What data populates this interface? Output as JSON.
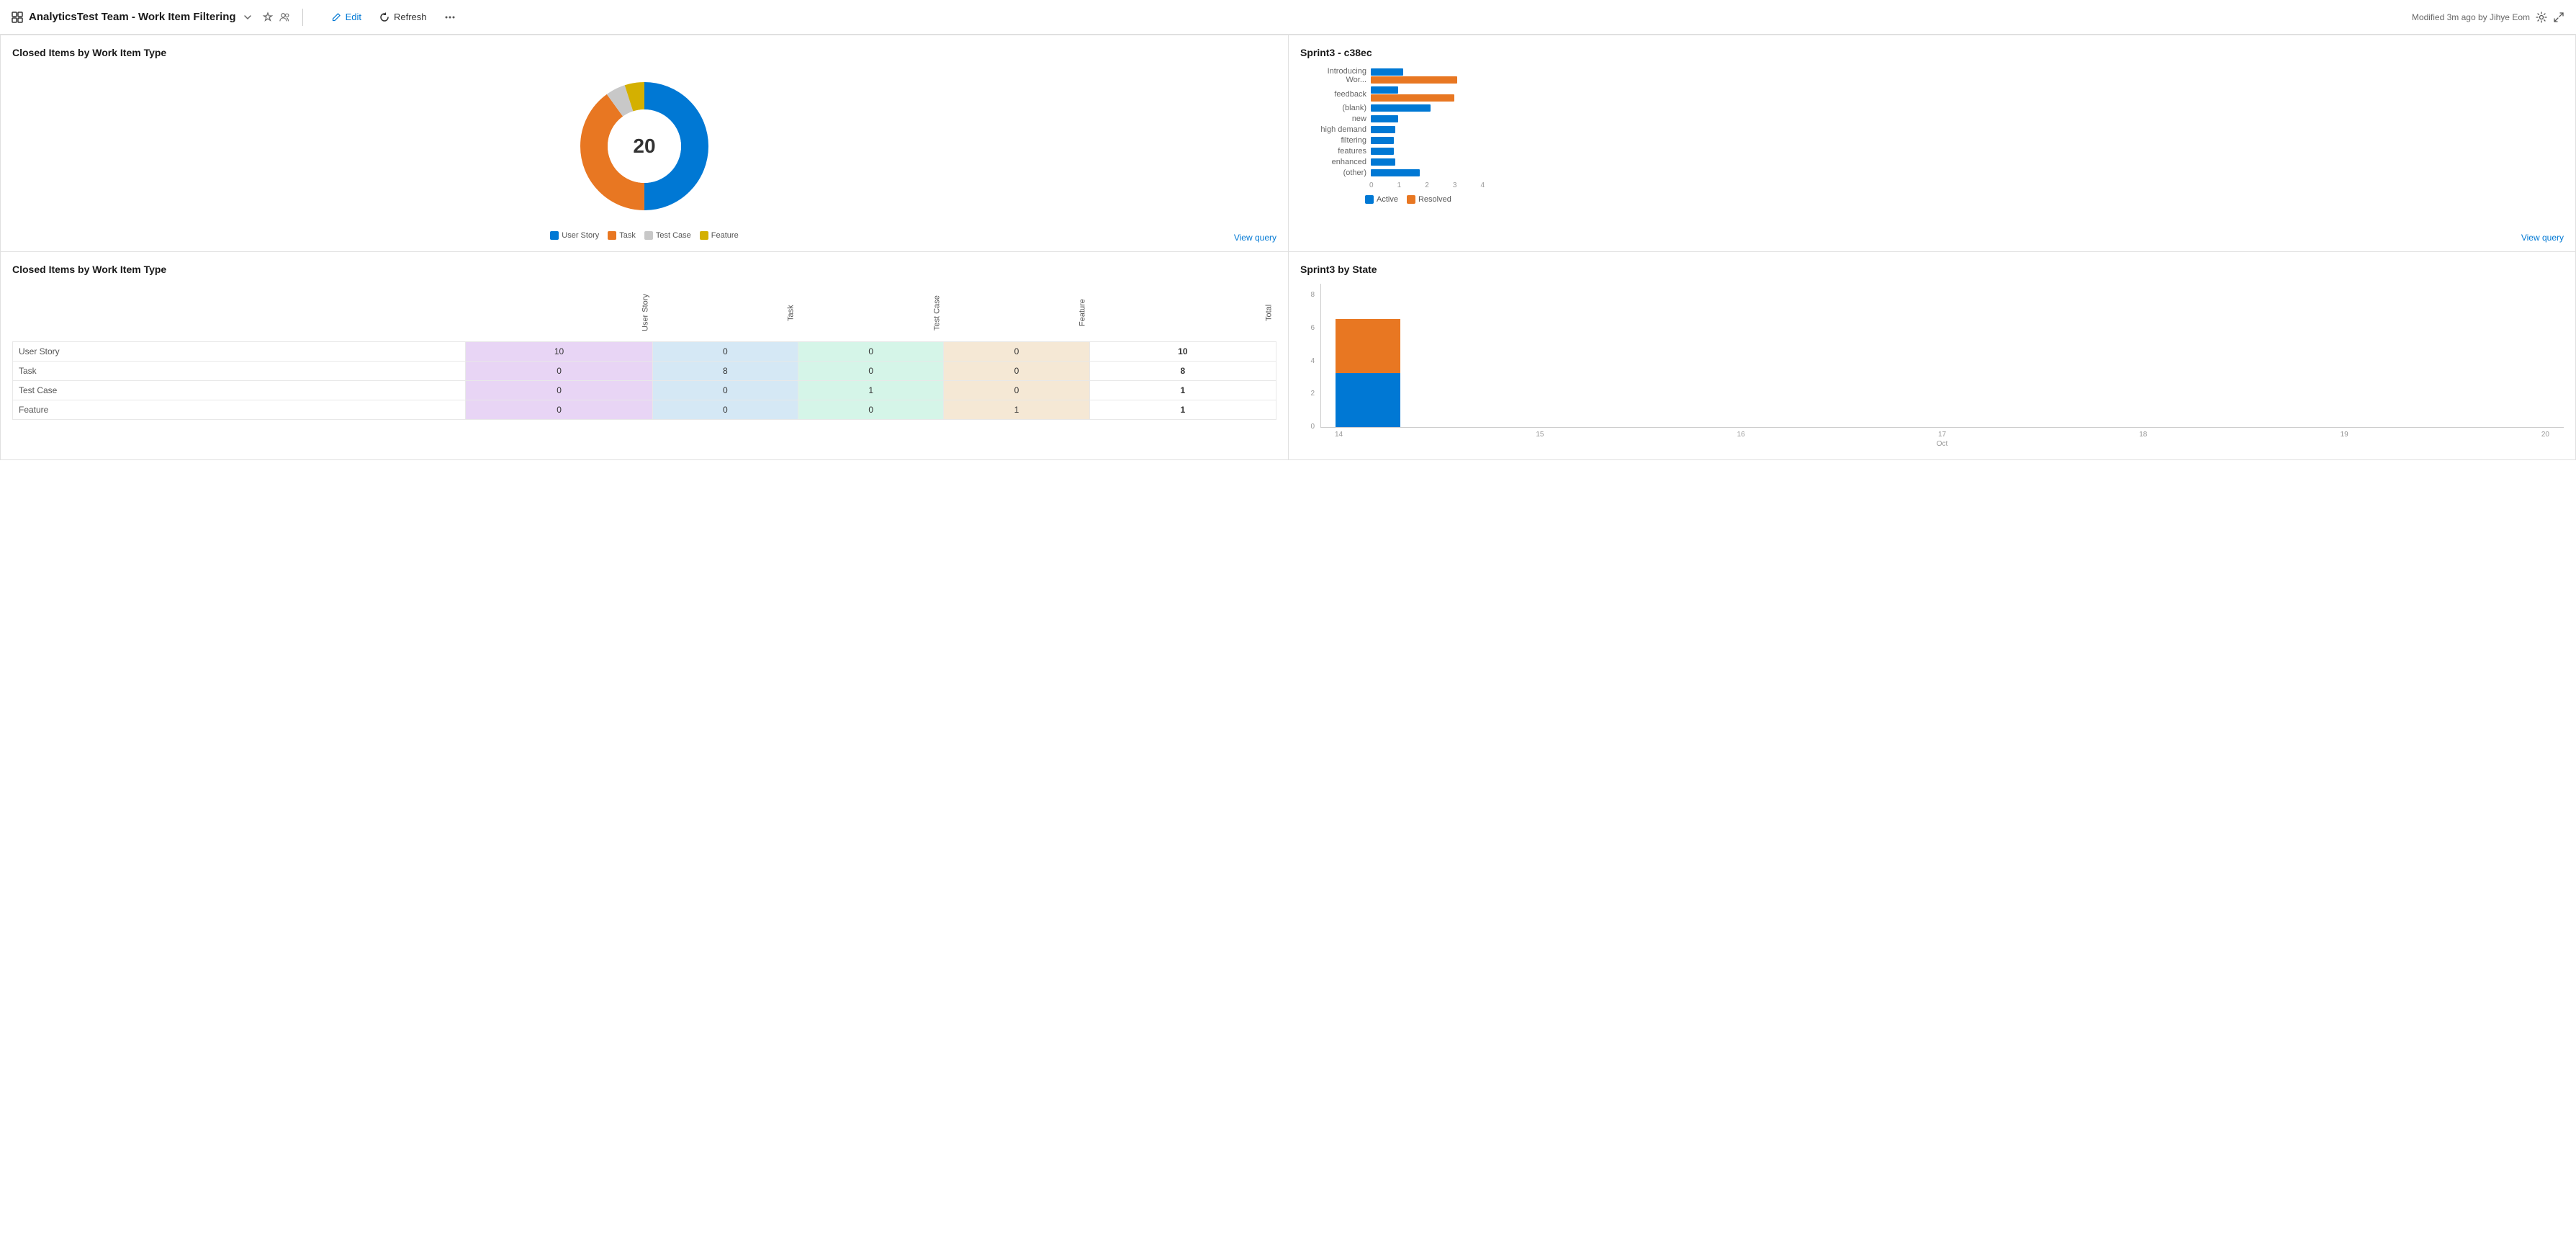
{
  "topbar": {
    "title": "AnalyticsTest Team - Work Item Filtering",
    "chevron_icon": "chevron-down",
    "star_icon": "star",
    "people_icon": "people",
    "edit_label": "Edit",
    "refresh_label": "Refresh",
    "more_icon": "ellipsis",
    "modified_text": "Modified 3m ago by Jihye Eom",
    "settings_icon": "settings",
    "expand_icon": "expand"
  },
  "widget1": {
    "title": "Closed Items by Work Item Type",
    "total": "20",
    "view_query": "View query",
    "donut": {
      "segments": [
        {
          "name": "User Story",
          "value": 10,
          "color": "#0078d4",
          "percent": 50
        },
        {
          "name": "Task",
          "value": 8,
          "color": "#e87722",
          "percent": 40
        },
        {
          "name": "Test Case",
          "value": 1,
          "color": "#c8c8c8",
          "percent": 5
        },
        {
          "name": "Feature",
          "value": 1,
          "color": "#d4b000",
          "percent": 5
        }
      ]
    },
    "labels": {
      "user_story": "User Story",
      "task": "Task",
      "test_case": "Test Case",
      "feature": "Feature"
    }
  },
  "widget2": {
    "title": "Sprint3 - c38ec",
    "view_query": "View query",
    "legend_active": "Active",
    "legend_resolved": "Resolved",
    "rows": [
      {
        "label": "Introducing Wor...",
        "active": 1.2,
        "resolved": 3.2
      },
      {
        "label": "feedback",
        "active": 1.0,
        "resolved": 3.1
      },
      {
        "label": "(blank)",
        "active": 2.2,
        "resolved": 0
      },
      {
        "label": "new",
        "active": 1.0,
        "resolved": 0
      },
      {
        "label": "high demand",
        "active": 0.9,
        "resolved": 0
      },
      {
        "label": "filtering",
        "active": 0.85,
        "resolved": 0
      },
      {
        "label": "features",
        "active": 0.85,
        "resolved": 0
      },
      {
        "label": "enhanced",
        "active": 0.9,
        "resolved": 0
      },
      {
        "label": "(other)",
        "active": 1.8,
        "resolved": 0
      }
    ],
    "axis": [
      "0",
      "1",
      "2",
      "3",
      "4"
    ]
  },
  "widget3": {
    "title": "Closed Items by Work Item Type",
    "col_headers": [
      "User Story",
      "Task",
      "Test Case",
      "Feature",
      "Total"
    ],
    "rows": [
      {
        "label": "User Story",
        "values": [
          10,
          0,
          0,
          0,
          10
        ]
      },
      {
        "label": "Task",
        "values": [
          0,
          8,
          0,
          0,
          8
        ]
      },
      {
        "label": "Test Case",
        "values": [
          0,
          0,
          1,
          0,
          1
        ]
      },
      {
        "label": "Feature",
        "values": [
          0,
          0,
          0,
          1,
          1
        ]
      }
    ]
  },
  "widget4": {
    "title": "Sprint3 by State",
    "y_labels": [
      "8",
      "6",
      "4",
      "2",
      "0"
    ],
    "bars": [
      {
        "x": "14",
        "active": 3,
        "resolved": 3
      }
    ],
    "x_labels": [
      "14",
      "15",
      "16",
      "17",
      "18",
      "19",
      "20"
    ],
    "x_month": "Oct",
    "max": 8
  }
}
